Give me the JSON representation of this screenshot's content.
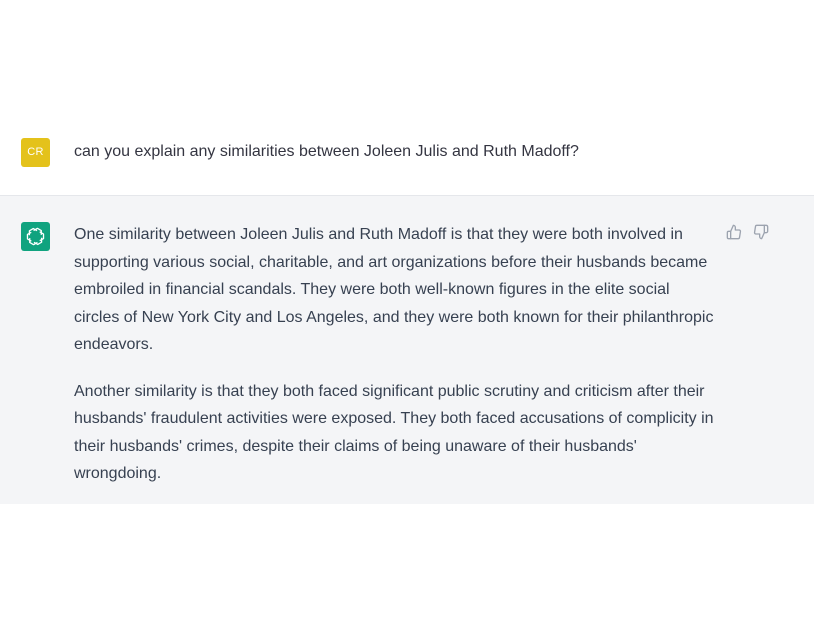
{
  "conversation": {
    "user_message": {
      "avatar_initials": "CR",
      "avatar_color": "#e4c21b",
      "text": "can you explain any similarities between Joleen Julis and Ruth Madoff?"
    },
    "assistant_message": {
      "avatar_icon": "openai-logo-icon",
      "avatar_color": "#10a37f",
      "paragraphs": [
        "One similarity between Joleen Julis and Ruth Madoff is that they were both involved in supporting various social, charitable, and art organizations before their husbands became embroiled in financial scandals. They were both well-known figures in the elite social circles of New York City and Los Angeles, and they were both known for their philanthropic endeavors.",
        "Another similarity is that they both faced significant public scrutiny and criticism after their husbands' fraudulent activities were exposed. They both faced accusations of complicity in their husbands' crimes, despite their claims of being unaware of their husbands' wrongdoing."
      ],
      "feedback": {
        "thumbs_up_icon": "thumbs-up-icon",
        "thumbs_down_icon": "thumbs-down-icon"
      }
    }
  },
  "colors": {
    "assistant_background": "#f4f5f7",
    "text": "#374151"
  }
}
